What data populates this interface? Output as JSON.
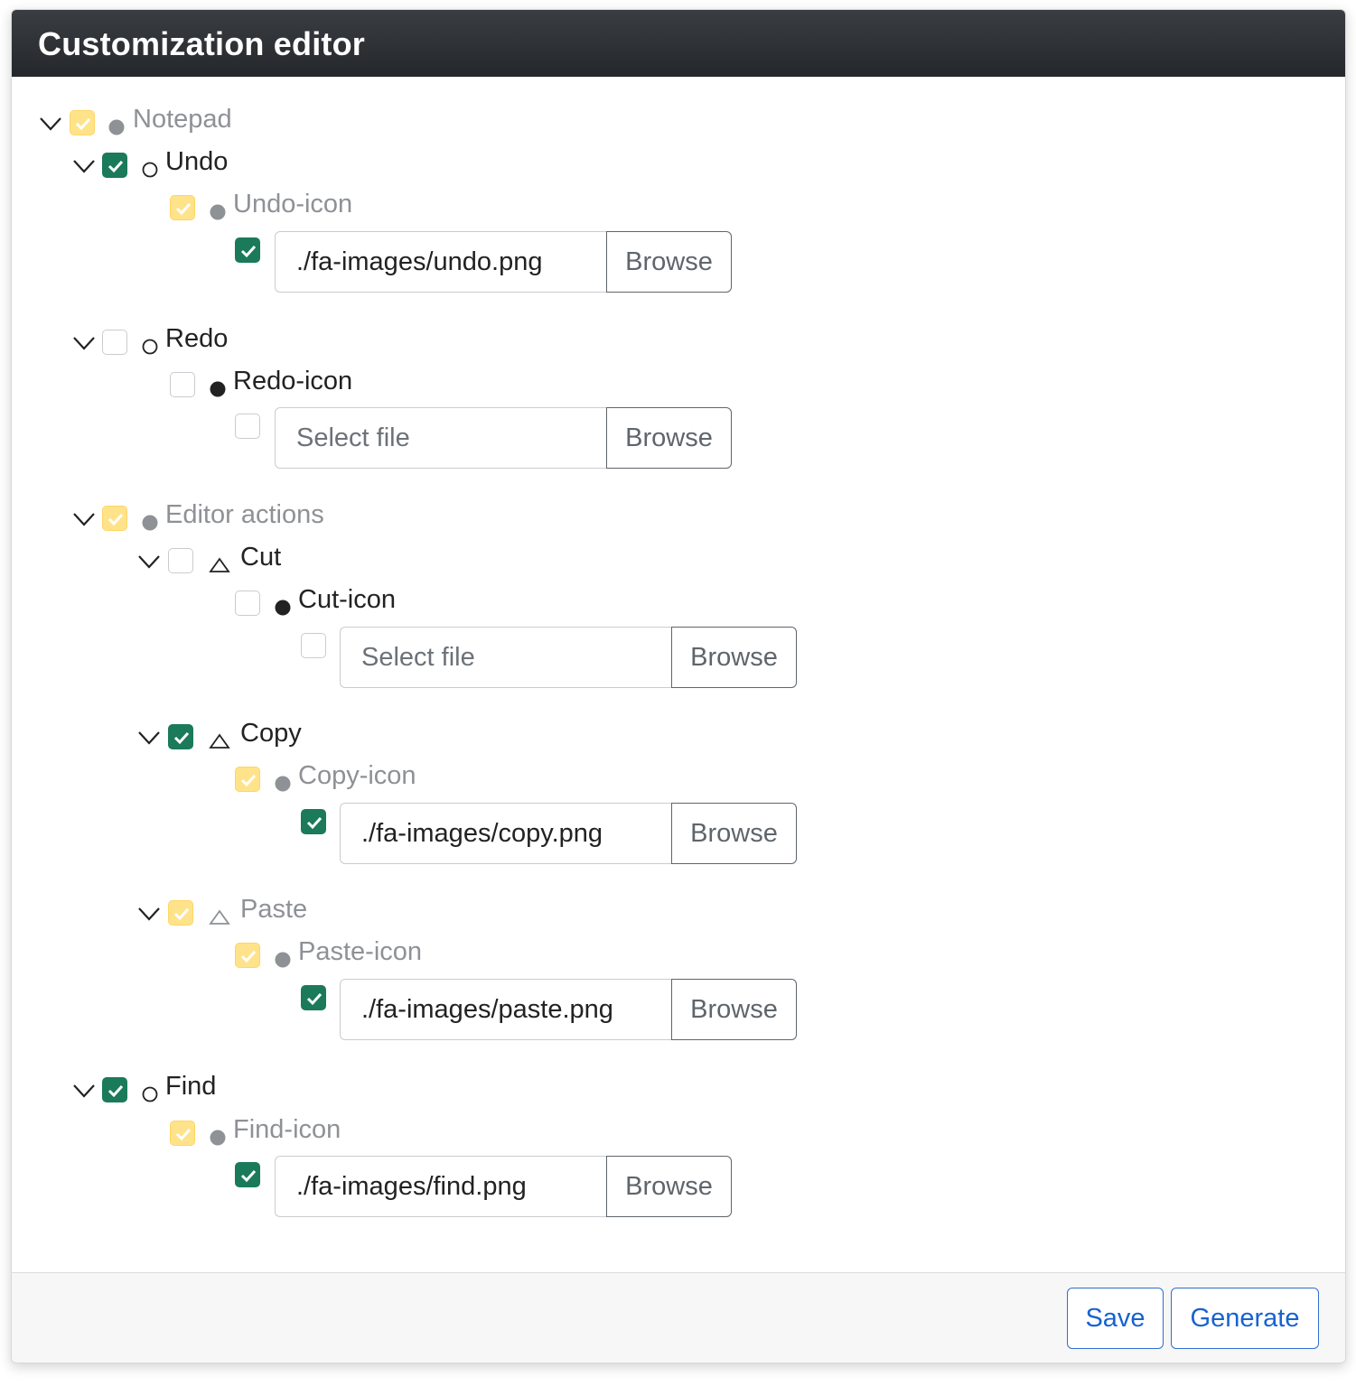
{
  "title": "Customization editor",
  "tree": {
    "notepad": "Notepad",
    "undo": "Undo",
    "undo_icon": "Undo-icon",
    "undo_file": "./fa-images/undo.png",
    "redo": "Redo",
    "redo_icon": "Redo-icon",
    "redo_file_placeholder": "Select file",
    "editor_actions": "Editor actions",
    "cut": "Cut",
    "cut_icon": "Cut-icon",
    "cut_file_placeholder": "Select file",
    "copy": "Copy",
    "copy_icon": "Copy-icon",
    "copy_file": "./fa-images/copy.png",
    "paste": "Paste",
    "paste_icon": "Paste-icon",
    "paste_file": "./fa-images/paste.png",
    "find": "Find",
    "find_icon": "Find-icon",
    "find_file": "./fa-images/find.png",
    "browse_label": "Browse"
  },
  "states": {
    "checked_color": "#1b7a5a",
    "partial_color": "#ffe38a"
  },
  "footer": {
    "save_label": "Save",
    "generate_label": "Generate"
  }
}
